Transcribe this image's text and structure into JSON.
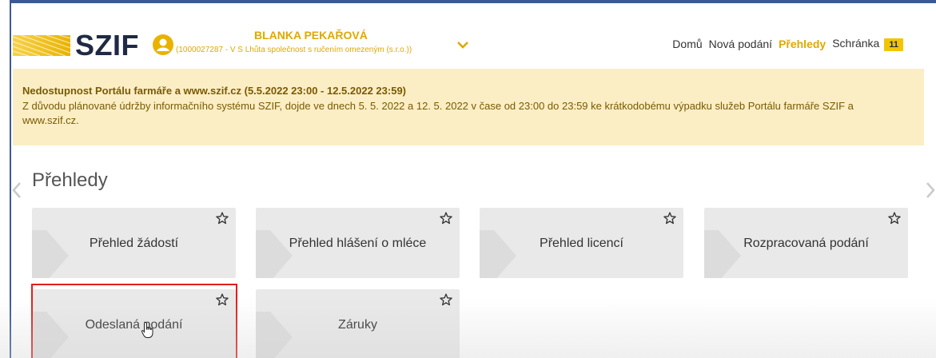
{
  "header": {
    "logo_text": "SZIF",
    "user_name": "BLANKA PEKAŘOVÁ",
    "user_subtitle": "(1000027287 - V S Lhůta společnost s ručením omezeným (s.r.o.))",
    "nav": {
      "home": "Domů",
      "new_submission": "Nová podání",
      "overviews": "Přehledy",
      "inbox": "Schránka",
      "inbox_count": "11"
    }
  },
  "notice": {
    "title": "Nedostupnost Portálu farmáře a www.szif.cz (5.5.2022 23:00 - 12.5.2022 23:59)",
    "text": "Z důvodu plánované údržby informačního systému SZIF, dojde ve dnech 5. 5. 2022 a 12. 5. 2022 v čase od 23:00 do 23:59 ke krátkodobému výpadku služeb Portálu farmáře SZIF a www.szif.cz."
  },
  "page": {
    "title": "Přehledy"
  },
  "tiles": [
    {
      "label": "Přehled žádostí"
    },
    {
      "label": "Přehled hlášení o mléce"
    },
    {
      "label": "Přehled licencí"
    },
    {
      "label": "Rozpracovaná podání"
    },
    {
      "label": "Odeslaná podání"
    },
    {
      "label": "Záruky"
    }
  ],
  "colors": {
    "accent": "#e0a800",
    "notice_bg": "#fbeec5",
    "tile_bg": "#e9e9e9",
    "highlight": "#e01e1e"
  }
}
